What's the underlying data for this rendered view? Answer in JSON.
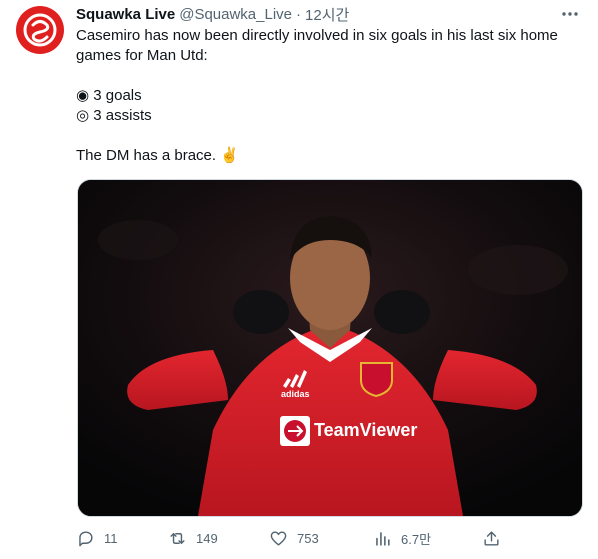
{
  "account": {
    "name": "Squawka Live",
    "handle": "@Squawka_Live",
    "separator": "·",
    "time": "12시간"
  },
  "tweet": {
    "line1": "Casemiro has now been directly involved in six goals in his last six home",
    "line2": "games for Man Utd:",
    "bullet1": "◉ 3 goals",
    "bullet2": "◎ 3 assists",
    "line3": "The DM has a brace. ✌️"
  },
  "media": {
    "sponsor_text": "TeamViewer",
    "kit_brand": "adidas"
  },
  "actions": {
    "replies": "11",
    "retweets": "149",
    "likes": "753",
    "views": "6.7만"
  },
  "colors": {
    "brand": "#e0201f",
    "shirt": "#d81e2a",
    "text": "#0f1419",
    "muted": "#536471"
  }
}
